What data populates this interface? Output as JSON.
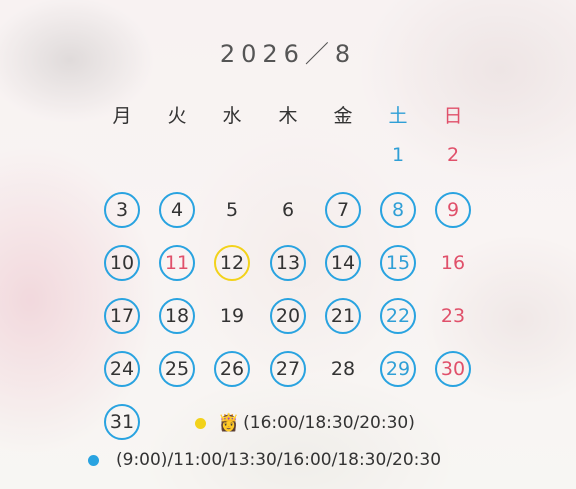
{
  "calendar": {
    "title": "2026／8",
    "weekdays": [
      "月",
      "火",
      "水",
      "木",
      "金",
      "土",
      "日"
    ],
    "days": [
      {
        "label": "1",
        "col": 5,
        "row": 0,
        "ring": false,
        "type": "sat"
      },
      {
        "label": "2",
        "col": 6,
        "row": 0,
        "ring": false,
        "type": "sun"
      },
      {
        "label": "3",
        "col": 0,
        "row": 1,
        "ring": true,
        "type": "normal"
      },
      {
        "label": "4",
        "col": 1,
        "row": 1,
        "ring": true,
        "type": "normal"
      },
      {
        "label": "5",
        "col": 2,
        "row": 1,
        "ring": false,
        "type": "normal"
      },
      {
        "label": "6",
        "col": 3,
        "row": 1,
        "ring": false,
        "type": "normal"
      },
      {
        "label": "7",
        "col": 4,
        "row": 1,
        "ring": true,
        "type": "normal"
      },
      {
        "label": "8",
        "col": 5,
        "row": 1,
        "ring": true,
        "type": "sat"
      },
      {
        "label": "9",
        "col": 6,
        "row": 1,
        "ring": true,
        "type": "sun"
      },
      {
        "label": "10",
        "col": 0,
        "row": 2,
        "ring": true,
        "type": "normal"
      },
      {
        "label": "11",
        "col": 1,
        "row": 2,
        "ring": true,
        "type": "hol"
      },
      {
        "label": "12",
        "col": 2,
        "row": 2,
        "ring": false,
        "today": true,
        "type": "normal"
      },
      {
        "label": "13",
        "col": 3,
        "row": 2,
        "ring": true,
        "type": "normal"
      },
      {
        "label": "14",
        "col": 4,
        "row": 2,
        "ring": true,
        "type": "normal"
      },
      {
        "label": "15",
        "col": 5,
        "row": 2,
        "ring": true,
        "type": "sat"
      },
      {
        "label": "16",
        "col": 6,
        "row": 2,
        "ring": false,
        "type": "sun"
      },
      {
        "label": "17",
        "col": 0,
        "row": 3,
        "ring": true,
        "type": "normal"
      },
      {
        "label": "18",
        "col": 1,
        "row": 3,
        "ring": true,
        "type": "normal"
      },
      {
        "label": "19",
        "col": 2,
        "row": 3,
        "ring": false,
        "type": "normal"
      },
      {
        "label": "20",
        "col": 3,
        "row": 3,
        "ring": true,
        "type": "normal"
      },
      {
        "label": "21",
        "col": 4,
        "row": 3,
        "ring": true,
        "type": "normal"
      },
      {
        "label": "22",
        "col": 5,
        "row": 3,
        "ring": true,
        "type": "sat"
      },
      {
        "label": "23",
        "col": 6,
        "row": 3,
        "ring": false,
        "type": "sun"
      },
      {
        "label": "24",
        "col": 0,
        "row": 4,
        "ring": true,
        "type": "normal"
      },
      {
        "label": "25",
        "col": 1,
        "row": 4,
        "ring": true,
        "type": "normal"
      },
      {
        "label": "26",
        "col": 2,
        "row": 4,
        "ring": true,
        "type": "normal"
      },
      {
        "label": "27",
        "col": 3,
        "row": 4,
        "ring": true,
        "type": "normal"
      },
      {
        "label": "28",
        "col": 4,
        "row": 4,
        "ring": false,
        "type": "normal"
      },
      {
        "label": "29",
        "col": 5,
        "row": 4,
        "ring": true,
        "type": "sat"
      },
      {
        "label": "30",
        "col": 6,
        "row": 4,
        "ring": true,
        "type": "sun"
      },
      {
        "label": "31",
        "col": 0,
        "row": 5,
        "ring": true,
        "type": "normal"
      }
    ]
  },
  "legend": {
    "yellow": {
      "text": "(16:00/18:30/20:30)",
      "icon": "crown-face-icon"
    },
    "blue": {
      "text": "(9:00)/11:00/13:30/16:00/18:30/20:30"
    }
  },
  "colors": {
    "ring_blue": "#29a3e0",
    "today_yellow": "#f2d21a",
    "saturday": "#2f9fd6",
    "sunday_holiday": "#e0506a"
  }
}
